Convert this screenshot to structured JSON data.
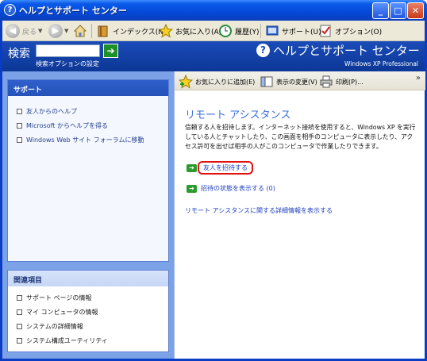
{
  "window": {
    "title": "ヘルプとサポート センター"
  },
  "toolbar": {
    "back_label": "戻る",
    "index_label": "インデックス(N)",
    "favorites_label": "お気に入り(A)",
    "history_label": "履歴(Y)",
    "support_label": "サポート(U)",
    "options_label": "オプション(O)"
  },
  "header": {
    "search_label": "検索",
    "search_value": "",
    "search_options_label": "検索オプションの設定",
    "brand_title": "ヘルプとサポート センター",
    "brand_subtitle": "Windows XP Professional"
  },
  "support_panel": {
    "heading": "サポート",
    "items": [
      "友人からのヘルプ",
      "Microsoft からヘルプを得る",
      "Windows Web サイト フォーラムに移動"
    ]
  },
  "related_panel": {
    "heading": "関連項目",
    "items": [
      "サポート ページの情報",
      "マイ コンピュータの情報",
      "システムの詳細情報",
      "システム構成ユーティリティ"
    ]
  },
  "content_toolbar": {
    "add_favorite_label": "お気に入りに追加(E)",
    "change_view_label": "表示の変更(V)",
    "print_label": "印刷(P)..."
  },
  "content": {
    "title": "リモート アシスタンス",
    "description": "信頼する人を招待します。インターネット接続を使用すると、Windows XP を実行している人とチャットしたり、この画面を相手のコンピュータに表示したり、アクセス許可を出せば相手の人がこのコンピュータで作業したりできます。",
    "invite_label": "友人を招待する",
    "status_label": "招待の状態を表示する (0)",
    "details_link": "リモート アシスタンスに関する詳細情報を表示する"
  }
}
